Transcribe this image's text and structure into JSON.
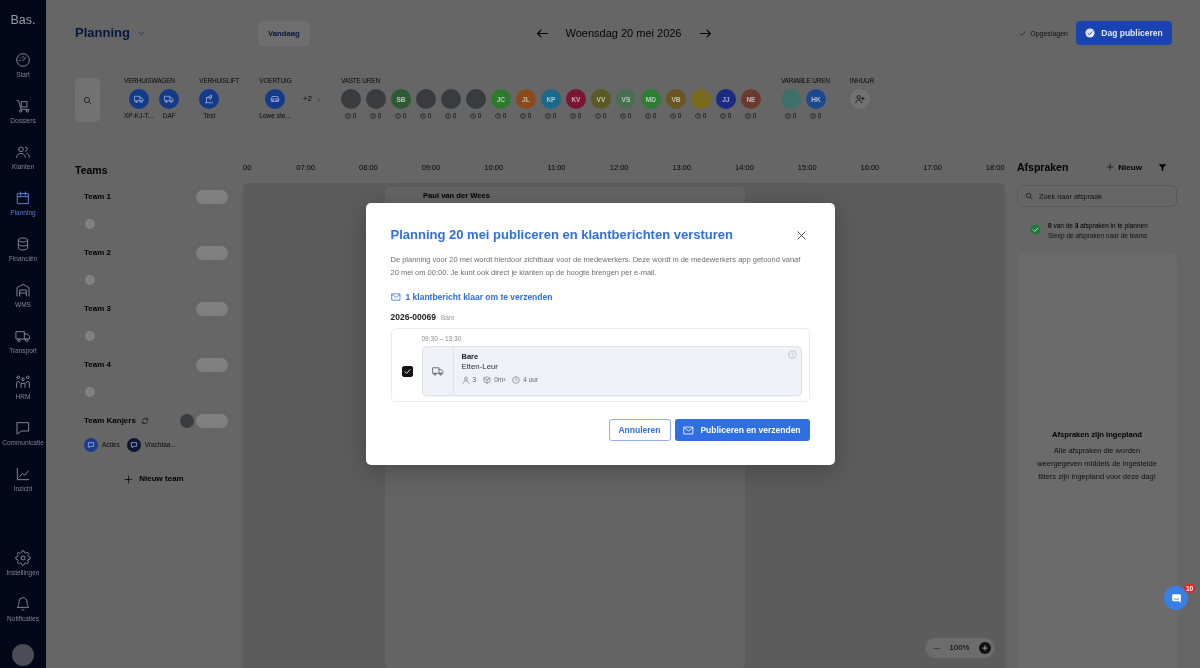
{
  "sidebar": {
    "logo": "Bas.",
    "items": [
      {
        "label": "Start",
        "selected": false
      },
      {
        "label": "Dossiers",
        "selected": false
      },
      {
        "label": "Klanten",
        "selected": false
      },
      {
        "label": "Planning",
        "selected": true
      },
      {
        "label": "Financiën",
        "selected": false
      },
      {
        "label": "WMS",
        "selected": false
      },
      {
        "label": "Transport",
        "selected": false
      },
      {
        "label": "HRM",
        "selected": false
      },
      {
        "label": "Communicatie",
        "selected": false
      },
      {
        "label": "Inzicht",
        "selected": false
      }
    ],
    "bottom_items": [
      {
        "label": "Instellingen",
        "selected": false
      },
      {
        "label": "Notificaties",
        "selected": false
      }
    ]
  },
  "header": {
    "title": "Planning",
    "today_button": "Vandaag",
    "date": "Woensdag 20 mei 2026",
    "saved_status": "Opgeslagen",
    "publish_button": "Dag publiceren"
  },
  "filters": {
    "groups": [
      {
        "label": "VERHUISWAGEN",
        "kind": "van",
        "items": [
          {
            "name": "XP-KJ-T..."
          },
          {
            "name": "DAF"
          }
        ]
      },
      {
        "label": "VERHUISLIFT",
        "kind": "lift",
        "items": [
          {
            "name": "Test"
          }
        ]
      },
      {
        "label": "VOERTUIG",
        "kind": "vehicle",
        "items": [
          {
            "name": "Lowe ste..."
          }
        ],
        "more": "+2"
      },
      {
        "label": "VASTE UREN",
        "kind": "staff",
        "items": [
          {
            "kind": "photo",
            "hours": "0"
          },
          {
            "kind": "photo",
            "hours": "0"
          },
          {
            "kind": "initials",
            "initials": "SB",
            "color": "#2d5a35",
            "hours": "0"
          },
          {
            "kind": "photo",
            "hours": "0"
          },
          {
            "kind": "photo",
            "hours": "0"
          },
          {
            "kind": "photo",
            "hours": "0"
          },
          {
            "kind": "initials",
            "initials": "JC",
            "color": "#2d7a2d",
            "hours": "0"
          },
          {
            "kind": "initials",
            "initials": "JL",
            "color": "#8a4a1a",
            "hours": "0"
          },
          {
            "kind": "initials",
            "initials": "KP",
            "color": "#1b6a8c",
            "hours": "0"
          },
          {
            "kind": "initials",
            "initials": "KV",
            "color": "#7a1632",
            "hours": "0"
          },
          {
            "kind": "initials",
            "initials": "VV",
            "color": "#5a5a24",
            "hours": "0"
          },
          {
            "kind": "initials",
            "initials": "VS",
            "color": "#4a6e52",
            "hours": "0"
          },
          {
            "kind": "initials",
            "initials": "MD",
            "color": "#2e7d34",
            "hours": "0"
          },
          {
            "kind": "initials",
            "initials": "VB",
            "color": "#6a5522",
            "hours": "0"
          },
          {
            "kind": "initials",
            "color": "#7a6a1e",
            "hours": "0"
          },
          {
            "kind": "initials",
            "initials": "JJ",
            "color": "#1b2a82",
            "hours": "0"
          },
          {
            "kind": "initials",
            "initials": "NE",
            "color": "#6a3a2e",
            "hours": "0"
          }
        ]
      },
      {
        "label": "VARIABLE UREN",
        "kind": "staff",
        "items": [
          {
            "kind": "initials",
            "color": "#3f6f6a",
            "hours": "0"
          },
          {
            "kind": "initials",
            "initials": "HK",
            "color": "#1d4a8e",
            "hours": "0"
          }
        ]
      },
      {
        "label": "INHUUR",
        "kind": "hire"
      }
    ]
  },
  "teams": {
    "title": "Teams",
    "items": [
      {
        "name": "Team 1",
        "synced": false
      },
      {
        "name": "Team 2",
        "synced": false
      },
      {
        "name": "Team 3",
        "synced": false
      },
      {
        "name": "Team 4",
        "synced": false
      },
      {
        "name": "Team Kanjers",
        "synced": true,
        "members": [
          {
            "kind": "photo"
          }
        ],
        "tags": [
          {
            "label": "Acties",
            "color": "#1e3a8a"
          },
          {
            "label": "Vrachtaa...",
            "color": "#0f1733"
          }
        ]
      }
    ],
    "add_button": "Nieuw team"
  },
  "timeline": {
    "hours": [
      "00",
      "07:00",
      "08:00",
      "09:00",
      "10:00",
      "11:00",
      "12:00",
      "13:00",
      "14:00",
      "15:00",
      "16:00",
      "17:00",
      "18:00"
    ],
    "bookings": [
      {
        "title": "Paul van der Wees"
      }
    ],
    "zoom": "100%"
  },
  "appointments_panel": {
    "title": "Afspraken",
    "new_button": "Nieuw",
    "search": {
      "placeholder": "Zoek naar afspraak"
    },
    "summary": "**0** van de **3** afspraken in te plannen",
    "hint": "Sleep de afspraken naar de teams",
    "empty_title": "Afspraken zijn ingepland",
    "empty_text": "Alle afspraken die worden weergegeven middels de ingestelde filters zijn ingepland voor deze dag!"
  },
  "chat_widget": {
    "badge": "10"
  },
  "modal": {
    "title": "Planning 20 mei publiceren en klantberichten versturen",
    "description": "De planning voor 20 mei wordt hierdoor zichtbaar voor de medewerkers. Deze wordt in de medewerkers app getoond vanaf 20 mei om 00:00. Je kunt ook direct je klanten op de hoogte brengen per e-mail.",
    "messages_link": "1 klantbericht klaar om te verzenden",
    "orders": [
      {
        "number": "2026-00069",
        "customer": "Bare",
        "appointments": [
          {
            "time": "09:30 – 13:30",
            "checked": true,
            "title": "Bare",
            "location": "Etten-Leur",
            "people": "3",
            "volume": "0m³",
            "duration": "4 uur"
          }
        ]
      }
    ],
    "cancel_button": "Annuleren",
    "confirm_button": "Publiceren en verzenden"
  }
}
